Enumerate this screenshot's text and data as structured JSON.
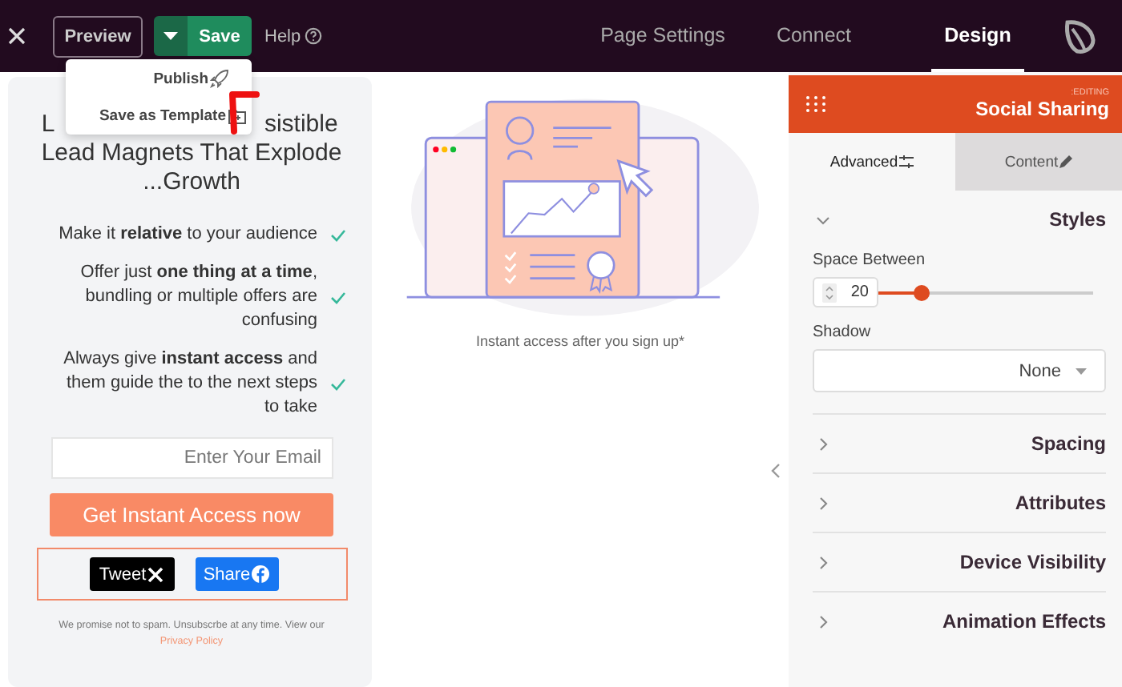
{
  "topbar": {
    "preview": "Preview",
    "save": "Save",
    "help": "Help",
    "tabs": [
      {
        "label": "Page Settings",
        "selected": false
      },
      {
        "label": "Connect",
        "selected": false
      },
      {
        "label": "Design",
        "selected": true
      }
    ]
  },
  "save_menu": [
    {
      "label": "Publish"
    },
    {
      "label": "Save as Template"
    }
  ],
  "card": {
    "heading_start": "L",
    "heading_end": "sistible",
    "heading_line2": "Lead Magnets That Explode",
    "heading_line3": "...Growth",
    "benefits": [
      "Make it **relative** to your audience",
      "Offer just **one thing at a time**, bundling or multiple offers are confusing",
      "Always give **instant access** and them guide the to the next steps to take"
    ],
    "email_placeholder": "Enter Your Email",
    "cta": "Get Instant Access now",
    "social": [
      "Tweet",
      "Share"
    ],
    "disclaimer": "We promise not to spam. Unsubscrbe at any time. View our",
    "privacy_link": "Privacy Policy"
  },
  "canvas": {
    "caption": "Instant access after you sign up*"
  },
  "panel": {
    "editing": ":EDITING",
    "element": "Social Sharing",
    "tabs": [
      {
        "label": "Advanced",
        "selected": true
      },
      {
        "label": "Content",
        "selected": false
      }
    ],
    "styles": {
      "title": "Styles",
      "expanded": true,
      "space_label": "Space Between",
      "space_value": "20",
      "level": 0.2,
      "shadow_label": "Shadow",
      "shadow_value": "None"
    },
    "sections": [
      {
        "title": "Spacing",
        "expanded": false
      },
      {
        "title": "Attributes",
        "expanded": false
      },
      {
        "title": "Device Visibility",
        "expanded": false
      },
      {
        "title": "Animation Effects",
        "expanded": false
      }
    ]
  }
}
